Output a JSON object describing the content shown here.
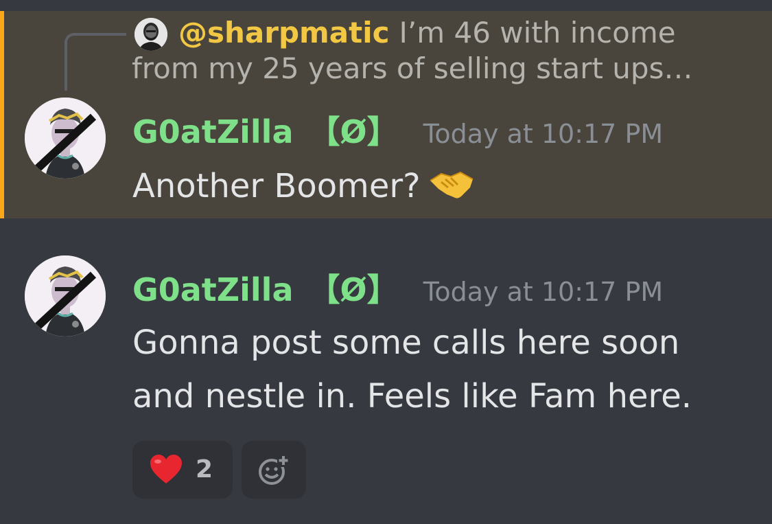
{
  "reply": {
    "mention": "@sharpmatic",
    "preview_line1": "I’m 46  with income",
    "preview_line2": "from my 25 years of selling start ups…",
    "avatar_icon": "person-avatar-icon"
  },
  "messages": [
    {
      "username": "G0atZilla",
      "badge": "【Ø】",
      "timestamp": "Today at 10:17 PM",
      "text": "Another Boomer?",
      "emoji": "handshake-emoji",
      "highlighted": true
    },
    {
      "username": "G0atZilla",
      "badge": "【Ø】",
      "timestamp": "Today at 10:17 PM",
      "text_line1": "Gonna post some calls here soon",
      "text_line2": "and nestle in. Feels like Fam here.",
      "reactions": [
        {
          "emoji": "heart-emoji",
          "count": "2"
        }
      ],
      "add_reaction_icon": "add-reaction-icon"
    }
  ],
  "colors": {
    "background": "#36393f",
    "highlight": "#49443c",
    "mention_bar": "#faa81a",
    "username": "#7fe08a",
    "mention": "#f2c744",
    "timestamp": "#8a8f96",
    "text": "#e4e5e7"
  }
}
